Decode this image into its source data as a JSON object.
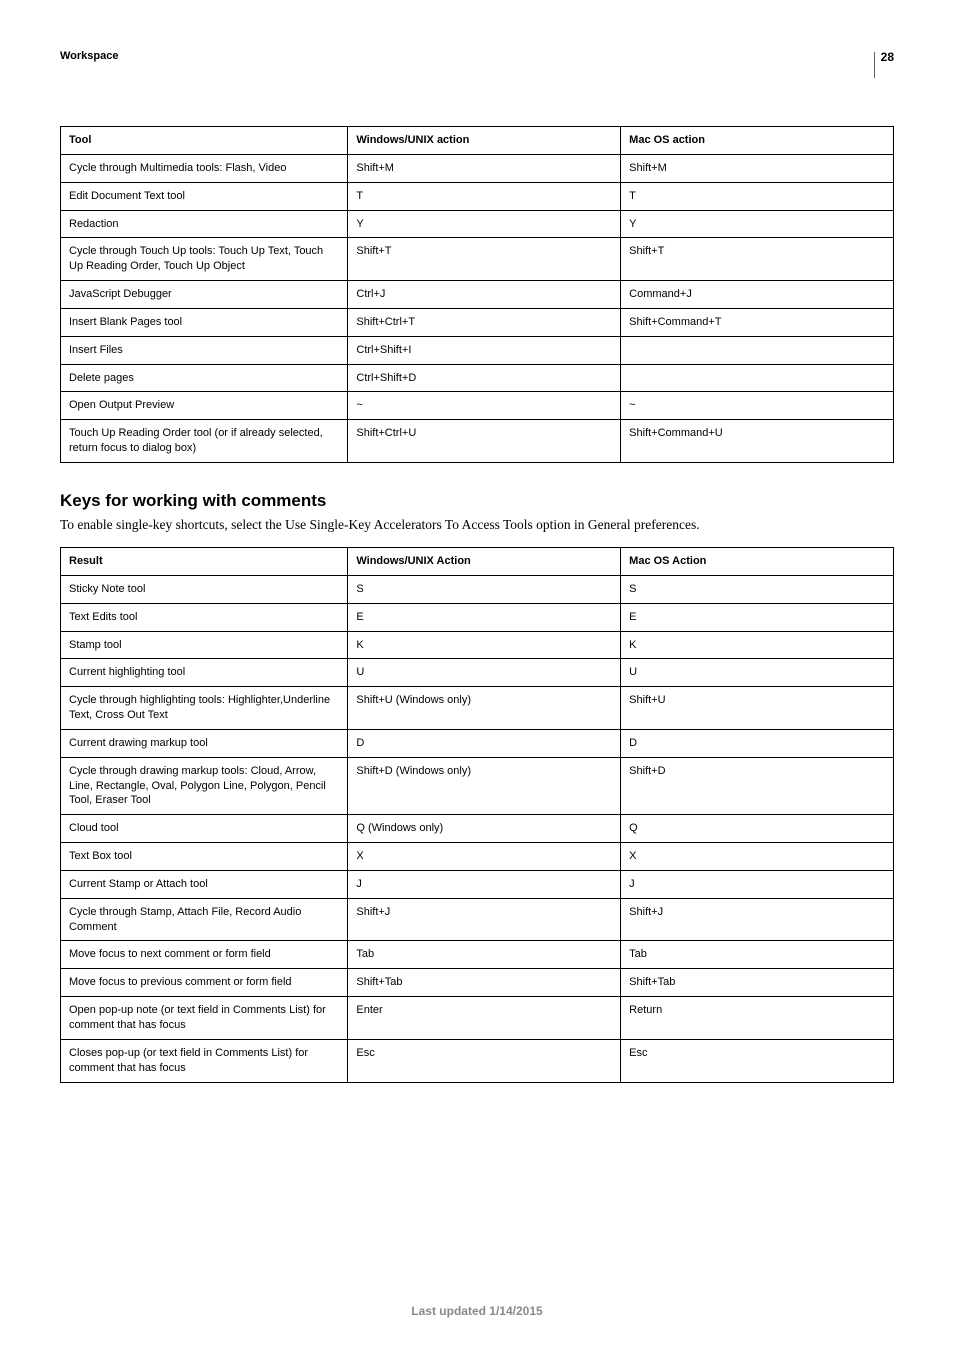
{
  "header": {
    "workspace": "Workspace",
    "page": "28"
  },
  "table1": {
    "headers": [
      "Tool",
      "Windows/UNIX action",
      "Mac OS action"
    ],
    "rows": [
      [
        "Cycle through Multimedia tools: Flash, Video",
        "Shift+M",
        "Shift+M"
      ],
      [
        "Edit Document Text tool",
        "T",
        "T"
      ],
      [
        "Redaction",
        "Y",
        "Y"
      ],
      [
        "Cycle through Touch Up tools: Touch Up Text, Touch Up Reading Order, Touch Up Object",
        "Shift+T",
        "Shift+T"
      ],
      [
        "JavaScript Debugger",
        "Ctrl+J",
        "Command+J"
      ],
      [
        "Insert Blank Pages tool",
        "Shift+Ctrl+T",
        "Shift+Command+T"
      ],
      [
        "Insert Files",
        "Ctrl+Shift+I",
        ""
      ],
      [
        "Delete pages",
        "Ctrl+Shift+D",
        ""
      ],
      [
        "Open Output Preview",
        "~",
        "~"
      ],
      [
        "Touch Up Reading Order tool (or if already selected, return focus to dialog box)",
        "Shift+Ctrl+U",
        "Shift+Command+U"
      ]
    ]
  },
  "section": {
    "title": "Keys for working with comments",
    "intro": "To enable single-key shortcuts, select the Use Single-Key Accelerators To Access Tools option in General preferences."
  },
  "table2": {
    "headers": [
      "Result",
      "Windows/UNIX Action",
      "Mac OS Action"
    ],
    "rows": [
      [
        "Sticky Note tool",
        "S",
        "S"
      ],
      [
        "Text Edits tool",
        "E",
        "E"
      ],
      [
        "Stamp tool",
        "K",
        "K"
      ],
      [
        "Current highlighting tool",
        "U",
        "U"
      ],
      [
        "Cycle through highlighting tools: Highlighter,Underline Text, Cross Out Text",
        "Shift+U (Windows only)",
        "Shift+U"
      ],
      [
        "Current drawing markup tool",
        "D",
        "D"
      ],
      [
        "Cycle through drawing markup tools: Cloud, Arrow, Line, Rectangle, Oval, Polygon Line, Polygon, Pencil Tool, Eraser Tool",
        "Shift+D (Windows only)",
        "Shift+D"
      ],
      [
        "Cloud tool",
        "Q (Windows only)",
        "Q"
      ],
      [
        "Text Box tool",
        "X",
        "X"
      ],
      [
        "Current Stamp or Attach tool",
        "J",
        "J"
      ],
      [
        "Cycle through Stamp, Attach File, Record Audio Comment",
        "Shift+J",
        "Shift+J"
      ],
      [
        "Move focus to next comment or form field",
        "Tab",
        "Tab"
      ],
      [
        "Move focus to previous comment or form field",
        "Shift+Tab",
        "Shift+Tab"
      ],
      [
        "Open pop-up note (or text field in Comments List) for comment that has focus",
        "Enter",
        "Return"
      ],
      [
        "Closes pop-up (or text field in Comments List) for comment that has focus",
        "Esc",
        "Esc"
      ]
    ]
  },
  "footer": "Last updated 1/14/2015"
}
